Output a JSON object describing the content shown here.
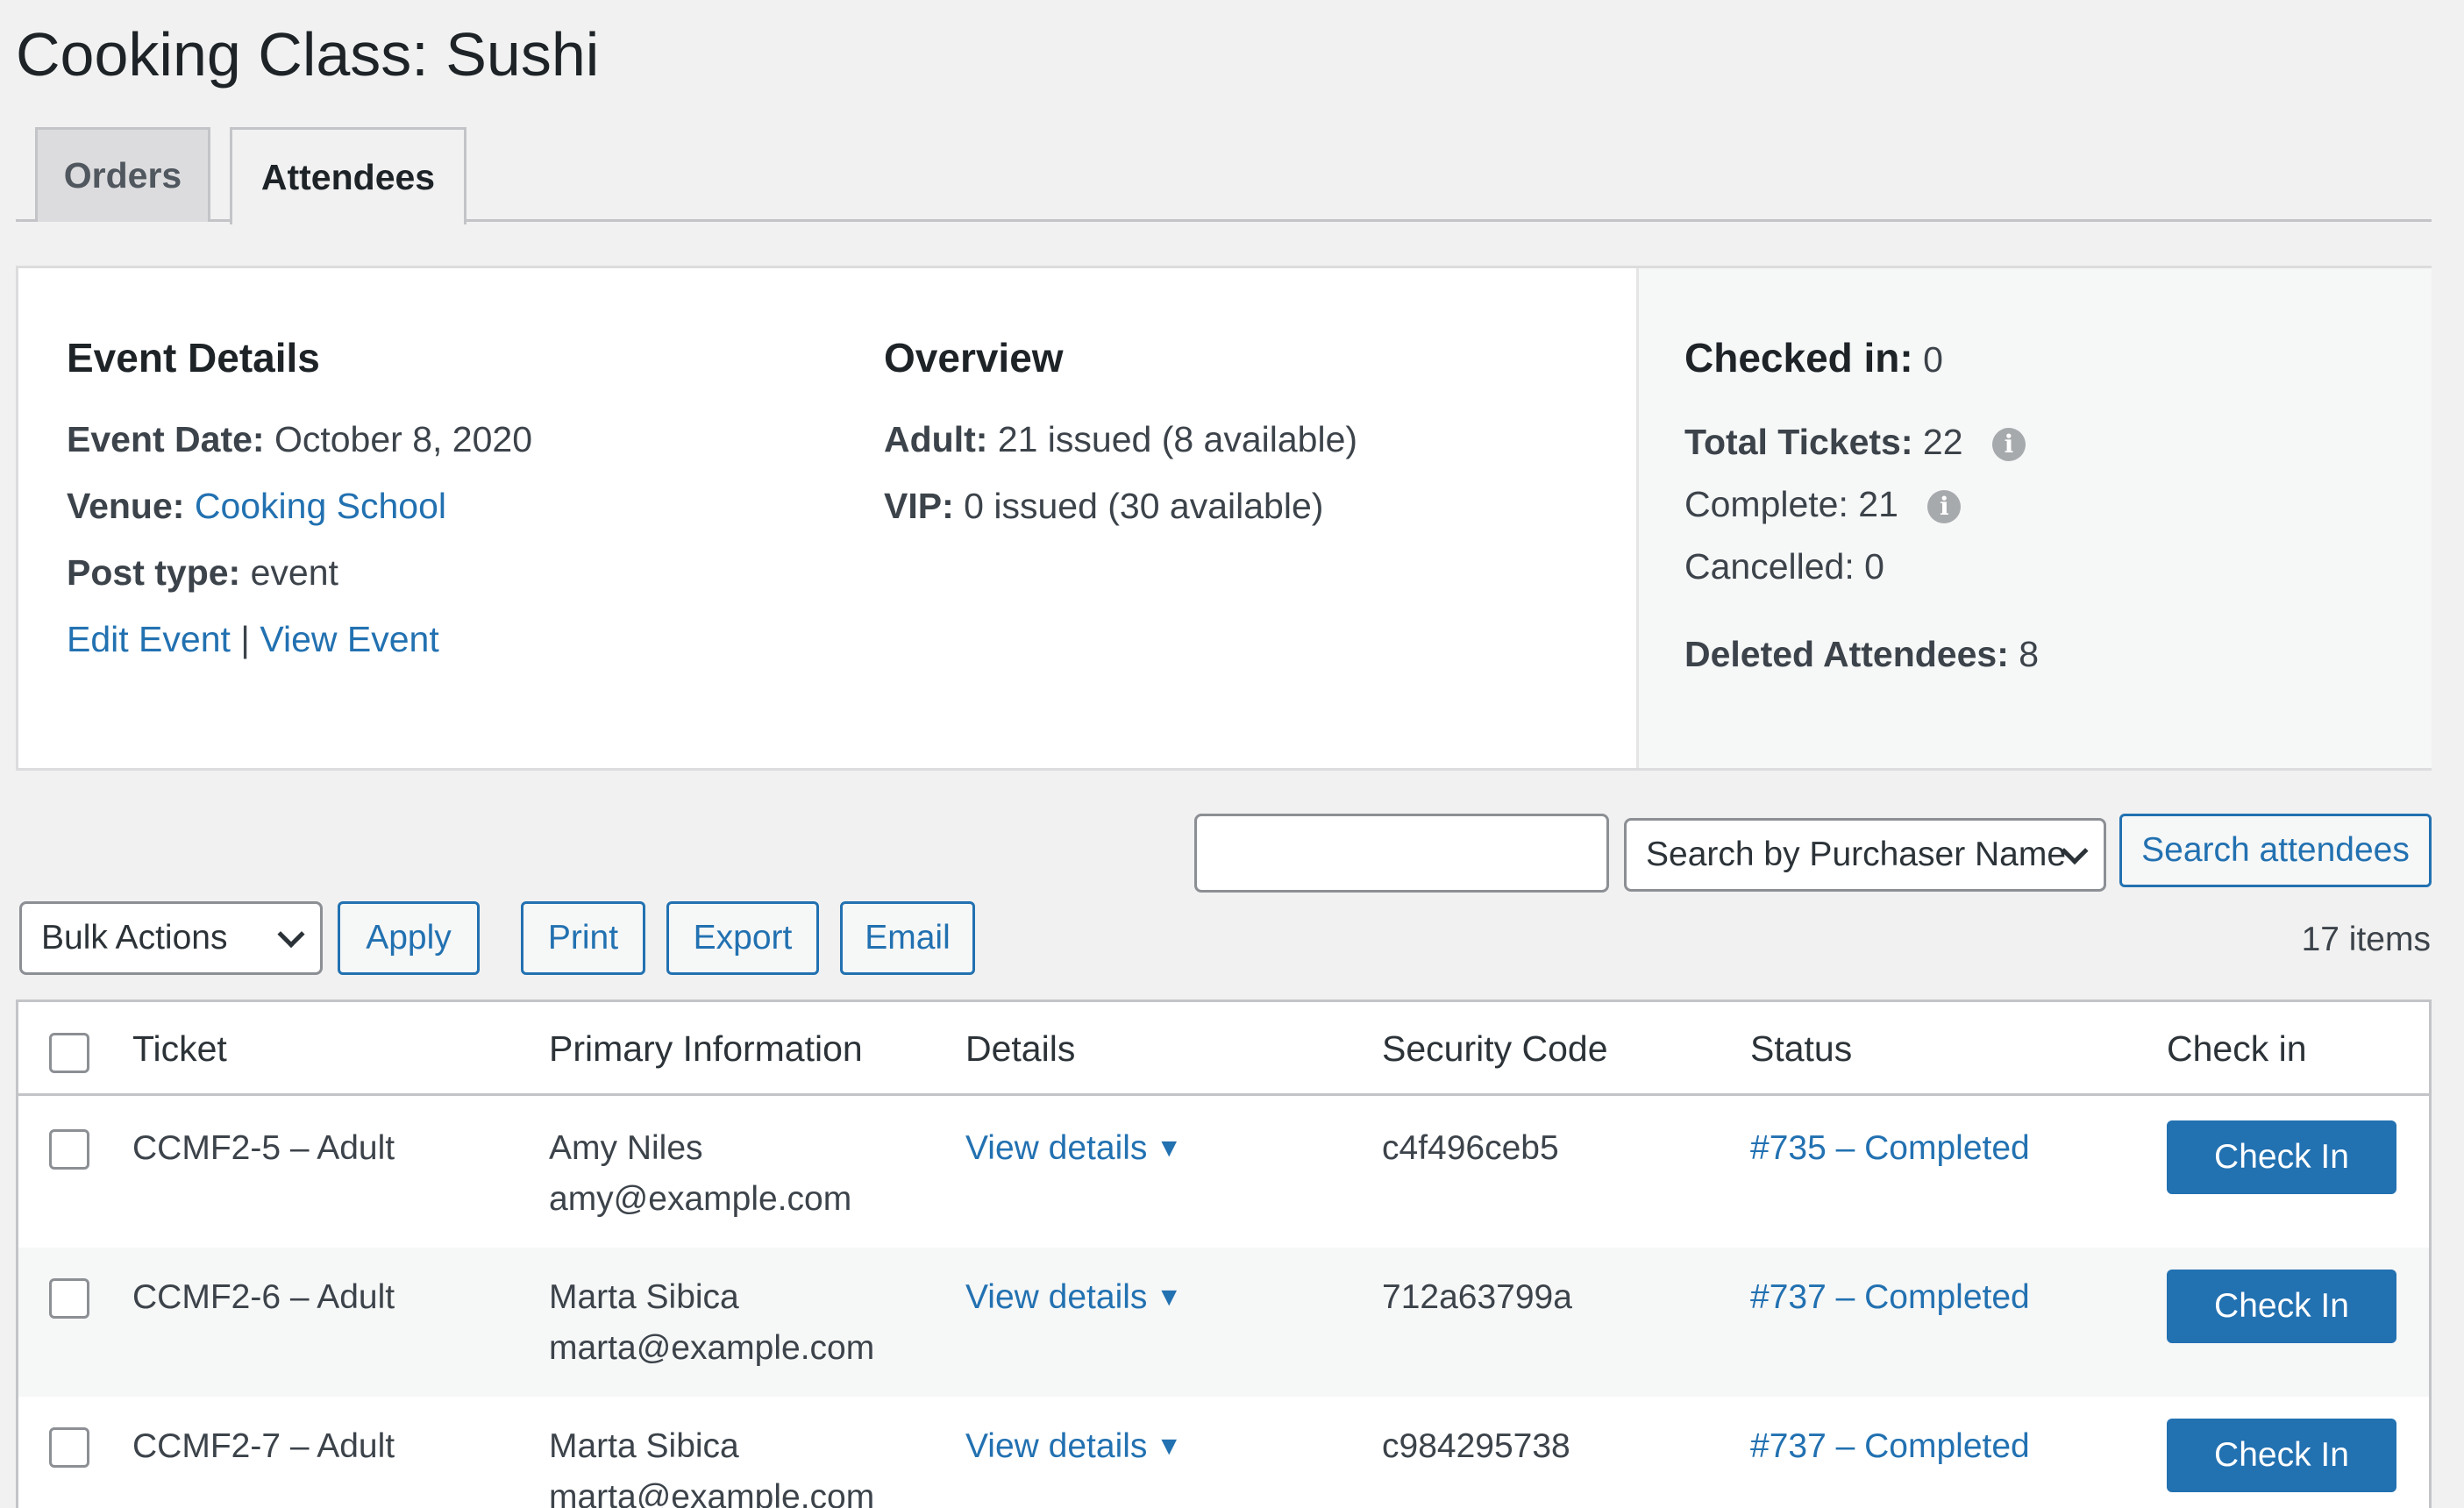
{
  "page": {
    "title": "Cooking Class: Sushi"
  },
  "tabs": [
    {
      "label": "Orders",
      "active": false
    },
    {
      "label": "Attendees",
      "active": true
    }
  ],
  "event_details": {
    "heading": "Event Details",
    "date_label": "Event Date:",
    "date_value": "October 8, 2020",
    "venue_label": "Venue:",
    "venue_value": "Cooking School",
    "post_type_label": "Post type:",
    "post_type_value": "event",
    "edit_link": "Edit Event",
    "separator": "|",
    "view_link": "View Event"
  },
  "overview": {
    "heading": "Overview",
    "adult_label": "Adult:",
    "adult_value": "21 issued (8 available)",
    "vip_label": "VIP:",
    "vip_value": "0 issued (30 available)"
  },
  "stats": {
    "checked_in_label": "Checked in:",
    "checked_in_value": "0",
    "total_label": "Total Tickets:",
    "total_value": "22",
    "complete_label": "Complete:",
    "complete_value": "21",
    "cancelled_label": "Cancelled:",
    "cancelled_value": "0",
    "deleted_label": "Deleted Attendees:",
    "deleted_value": "8",
    "info_glyph": "i"
  },
  "search": {
    "input_value": "",
    "field_select": "Search by Purchaser Name",
    "button": "Search attendees"
  },
  "toolbar": {
    "bulk_actions": "Bulk Actions",
    "apply": "Apply",
    "print": "Print",
    "export": "Export",
    "email": "Email",
    "items_count": "17 items"
  },
  "table": {
    "columns": [
      "Ticket",
      "Primary Information",
      "Details",
      "Security Code",
      "Status",
      "Check in"
    ],
    "rows": [
      {
        "ticket": "CCMF2-5 – Adult",
        "name": "Amy Niles",
        "email": "amy@example.com",
        "details": "View details",
        "code": "c4f496ceb5",
        "status": "#735 – Completed",
        "action": "Check In"
      },
      {
        "ticket": "CCMF2-6 – Adult",
        "name": "Marta Sibica",
        "email": "marta@example.com",
        "details": "View details",
        "code": "712a63799a",
        "status": "#737 – Completed",
        "action": "Check In"
      },
      {
        "ticket": "CCMF2-7 – Adult",
        "name": "Marta Sibica",
        "email": "marta@example.com",
        "details": "View details",
        "code": "c984295738",
        "status": "#737 – Completed",
        "action": "Check In"
      }
    ],
    "caret_glyph": "▼"
  },
  "colors": {
    "link": "#2271b1",
    "primary_button": "#2271b1",
    "background": "#f1f1f1"
  }
}
